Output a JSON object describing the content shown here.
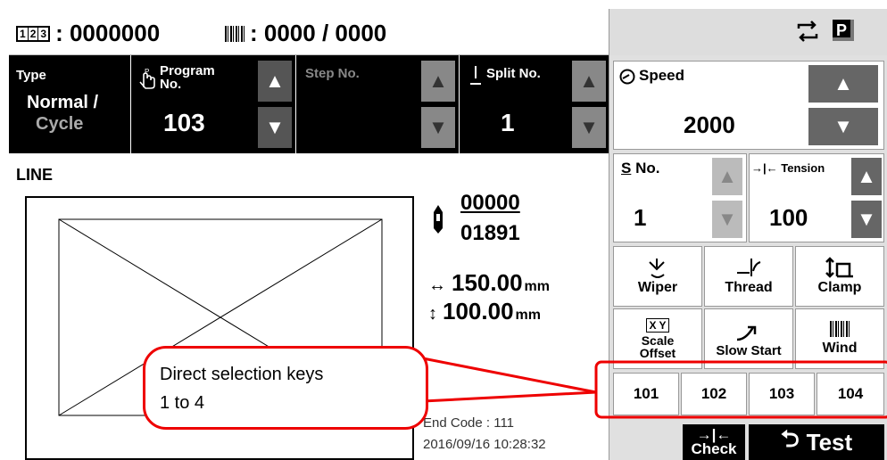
{
  "header": {
    "counter_icon_text": [
      "1",
      "2",
      "3"
    ],
    "counter_value": ": 0000000",
    "bobbin_value": ": 0000 / 0000"
  },
  "type_panel": {
    "label": "Type",
    "value_line1": "Normal /",
    "value_line2": "Cycle"
  },
  "program_panel": {
    "label": "Program\nNo.",
    "label1": "Program",
    "label2": "No.",
    "value": "103"
  },
  "step_panel": {
    "label": "Step No."
  },
  "split_panel": {
    "label": "Split No.",
    "value": "1"
  },
  "pattern": {
    "name": "LINE",
    "stitch_current": "00000",
    "stitch_total": "01891",
    "width": "150.00",
    "height": "100.00",
    "unit": "mm",
    "end_code": "End Code : 111",
    "datetime": "2016/09/16 10:28:32"
  },
  "speed": {
    "label": "Speed",
    "value": "2000"
  },
  "s_no": {
    "label": "No.",
    "prefix": "S",
    "value": "1"
  },
  "tension": {
    "label": "Tension",
    "value": "100"
  },
  "function_keys": [
    {
      "label": "Wiper"
    },
    {
      "label": "Thread"
    },
    {
      "label": "Clamp"
    },
    {
      "label_top": "X Y",
      "label": "Scale",
      "label2": "Offset"
    },
    {
      "label": "Slow Start"
    },
    {
      "label": "Wind"
    }
  ],
  "direct_keys": [
    "101",
    "102",
    "103",
    "104"
  ],
  "bottom": {
    "check_label": "Check",
    "test_label": "Test"
  },
  "callout": {
    "line1": "Direct selection keys",
    "line2": "1 to 4"
  },
  "colors": {
    "callout_red": "#e00000",
    "panel_black": "#000000",
    "button_grey": "#555555"
  }
}
